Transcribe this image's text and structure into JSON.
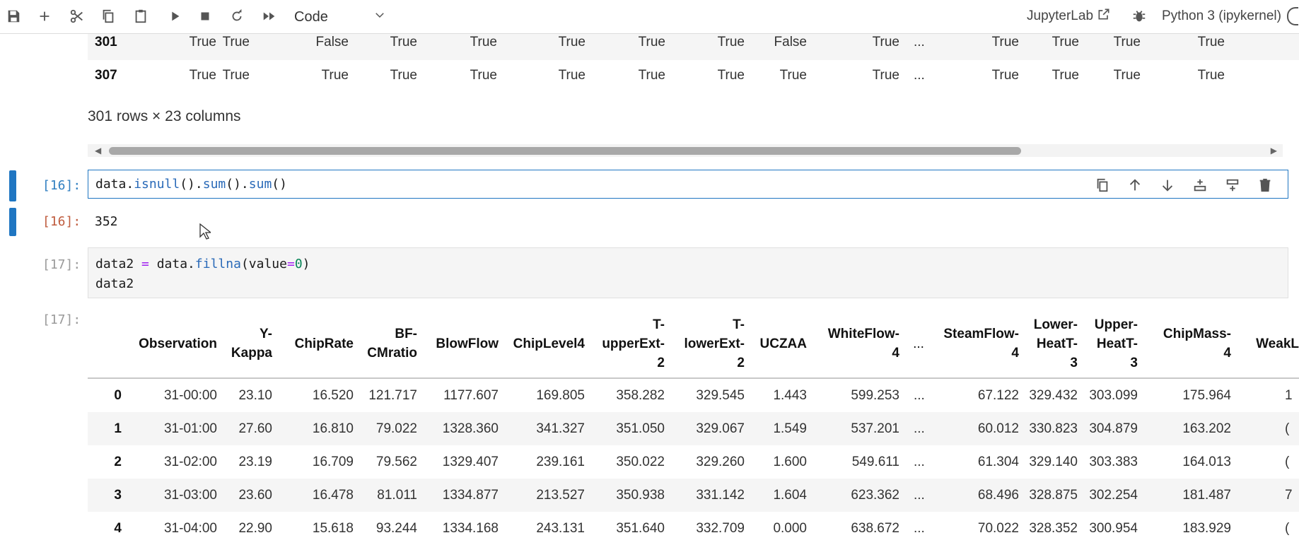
{
  "toolbar": {
    "cell_type": "Code",
    "jupyterlab_label": "JupyterLab",
    "kernel_label": "Python 3 (ipykernel)"
  },
  "top_output": {
    "rows": [
      {
        "index": "301",
        "values": [
          "True",
          "True",
          "False",
          "True",
          "True",
          "True",
          "True",
          "True",
          "False",
          "True",
          "...",
          "True",
          "True",
          "True",
          "True"
        ]
      },
      {
        "index": "307",
        "values": [
          "True",
          "True",
          "True",
          "True",
          "True",
          "True",
          "True",
          "True",
          "True",
          "True",
          "...",
          "True",
          "True",
          "True",
          "True"
        ]
      }
    ],
    "shape_text": "301 rows × 23 columns"
  },
  "cell16": {
    "in_prompt": "[16]:",
    "out_prompt": "[16]:",
    "code": "data.isnull().sum().sum()",
    "output": "352"
  },
  "cell17": {
    "in_prompt": "[17]:",
    "out_prompt": "[17]:",
    "code_line1": "data2 = data.fillna(value=0)",
    "code_line2": "data2"
  },
  "dataframe": {
    "columns": [
      "",
      "Observation",
      "Y-\nKappa",
      "ChipRate",
      "BF-\nCMratio",
      "BlowFlow",
      "ChipLevel4",
      "T-\nupperExt-\n2",
      "T-\nlowerExt-\n2",
      "UCZAA",
      "WhiteFlow-\n4",
      "...",
      "SteamFlow-\n4",
      "Lower-\nHeatT-\n3",
      "Upper-\nHeatT-\n3",
      "ChipMass-\n4",
      "WeakL"
    ],
    "rows": [
      [
        "0",
        "31-00:00",
        "23.10",
        "16.520",
        "121.717",
        "1177.607",
        "169.805",
        "358.282",
        "329.545",
        "1.443",
        "599.253",
        "...",
        "67.122",
        "329.432",
        "303.099",
        "175.964",
        "1"
      ],
      [
        "1",
        "31-01:00",
        "27.60",
        "16.810",
        "79.022",
        "1328.360",
        "341.327",
        "351.050",
        "329.067",
        "1.549",
        "537.201",
        "...",
        "60.012",
        "330.823",
        "304.879",
        "163.202",
        "("
      ],
      [
        "2",
        "31-02:00",
        "23.19",
        "16.709",
        "79.562",
        "1329.407",
        "239.161",
        "350.022",
        "329.260",
        "1.600",
        "549.611",
        "...",
        "61.304",
        "329.140",
        "303.383",
        "164.013",
        "("
      ],
      [
        "3",
        "31-03:00",
        "23.60",
        "16.478",
        "81.011",
        "1334.877",
        "213.527",
        "350.938",
        "331.142",
        "1.604",
        "623.362",
        "...",
        "68.496",
        "328.875",
        "302.254",
        "181.487",
        "7"
      ],
      [
        "4",
        "31-04:00",
        "22.90",
        "15.618",
        "93.244",
        "1334.168",
        "243.131",
        "351.640",
        "332.709",
        "0.000",
        "638.672",
        "...",
        "70.022",
        "328.352",
        "300.954",
        "183.929",
        "("
      ]
    ]
  }
}
